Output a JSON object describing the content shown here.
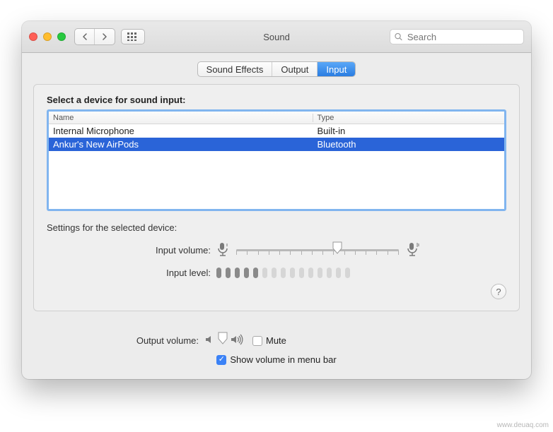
{
  "header": {
    "title": "Sound",
    "search_placeholder": "Search"
  },
  "tabs": [
    {
      "label": "Sound Effects",
      "active": false
    },
    {
      "label": "Output",
      "active": false
    },
    {
      "label": "Input",
      "active": true
    }
  ],
  "input_section": {
    "heading": "Select a device for sound input:",
    "columns": {
      "name": "Name",
      "type": "Type"
    },
    "devices": [
      {
        "name": "Internal Microphone",
        "type": "Built-in",
        "selected": false
      },
      {
        "name": "Ankur's New AirPods",
        "type": "Bluetooth",
        "selected": true
      }
    ]
  },
  "settings": {
    "heading": "Settings for the selected device:",
    "input_volume_label": "Input volume:",
    "input_volume_percent": 62,
    "input_level_label": "Input level:",
    "input_level_segments_on": 5,
    "input_level_segments_total": 15
  },
  "output": {
    "label": "Output volume:",
    "volume_percent": 70,
    "mute_label": "Mute",
    "mute_checked": false,
    "show_in_menu_label": "Show volume in menu bar",
    "show_in_menu_checked": true
  },
  "help_button": "?",
  "watermark": "www.deuaq.com"
}
